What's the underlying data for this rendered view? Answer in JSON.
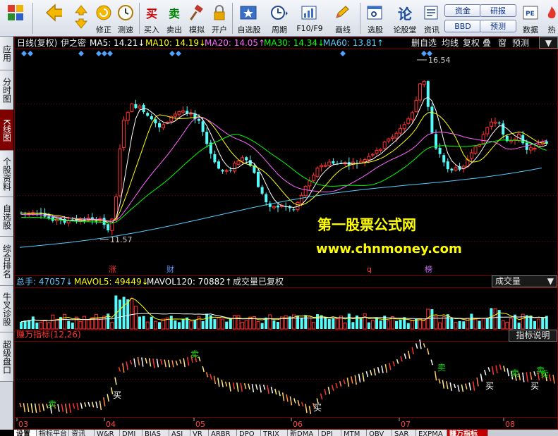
{
  "toolbar": {
    "buttons": [
      {
        "name": "fupan-button",
        "label": "",
        "icon": "grid-logo-icon"
      },
      {
        "name": "back-button",
        "label": "",
        "icon": "back-arrow-icon"
      },
      {
        "name": "up-button",
        "label": "",
        "icon": "up-arrow-icon"
      },
      {
        "name": "down-button",
        "label": "",
        "icon": "down-arrow-icon"
      },
      {
        "name": "xiuzheng-button",
        "label": "修正",
        "icon": "refresh-circle-icon"
      },
      {
        "name": "cesu-button",
        "label": "测速",
        "icon": "clock-icon"
      },
      {
        "name": "buy-button",
        "label": "买入",
        "icon": "buy-char-icon"
      },
      {
        "name": "sell-button",
        "label": "卖出",
        "icon": "sell-char-icon"
      },
      {
        "name": "simulate-button",
        "label": "模拟",
        "icon": "hammer-icon"
      },
      {
        "name": "open-account-button",
        "label": "开户",
        "icon": "lock-icon"
      },
      {
        "name": "watchlist-button",
        "label": "自选股",
        "icon": "star-window-icon"
      },
      {
        "name": "period-button",
        "label": "周期",
        "icon": "period-icon"
      },
      {
        "name": "f10-button",
        "label": "F10/F9",
        "icon": "f10-icon"
      },
      {
        "name": "drawline-button",
        "label": "画线",
        "icon": "pencil-icon"
      },
      {
        "name": "select-stock-button",
        "label": "选股",
        "icon": "select-window-icon"
      },
      {
        "name": "forum-button",
        "label": "论股堂",
        "icon": "forum-char-icon"
      },
      {
        "name": "info-button",
        "label": "资讯",
        "icon": "info-icon"
      },
      {
        "name": "data-button",
        "label": "数据",
        "icon": "pe-icon"
      },
      {
        "name": "hot-button",
        "label": "热",
        "icon": "fire-icon"
      }
    ],
    "pills": [
      "资金",
      "研报",
      "BBD",
      "预测"
    ]
  },
  "left_tabs": [
    {
      "label": "应用",
      "active": false
    },
    {
      "label": "分时图",
      "active": false
    },
    {
      "label": "K线图",
      "active": true
    },
    {
      "label": "个股资料",
      "active": false
    },
    {
      "label": "自选股",
      "active": false
    },
    {
      "label": "综合排名",
      "active": false
    },
    {
      "label": "牛叉诊股",
      "active": false
    },
    {
      "label": "超级盘口",
      "active": false
    }
  ],
  "main_header": {
    "period": "日线(复权)",
    "stock": "伊之密",
    "ma": [
      {
        "label": "MA5:",
        "value": "14.21",
        "arrow": "↓",
        "color": "#ffffff"
      },
      {
        "label": "MA10:",
        "value": "14.19",
        "arrow": "↓",
        "color": "#ffff00"
      },
      {
        "label": "MA20:",
        "value": "14.05",
        "arrow": "↑",
        "color": "#ff66ff"
      },
      {
        "label": "MA30:",
        "value": "14.34",
        "arrow": "↓",
        "color": "#00ff00"
      },
      {
        "label": "MA60:",
        "value": "13.81",
        "arrow": "↑",
        "color": "#55ccff"
      }
    ],
    "right_tools": [
      "删自选",
      "均线",
      "复权",
      "叠",
      "窗",
      "预测"
    ]
  },
  "price_labels": {
    "high": "16.54",
    "low": "11.57"
  },
  "event_markers": [
    {
      "label": "涨",
      "color": "#ff3333"
    },
    {
      "label": "财",
      "color": "#5599ff"
    },
    {
      "label": "q",
      "color": "#ff3333"
    },
    {
      "label": "榜",
      "color": "#cc66ff"
    }
  ],
  "watermark": {
    "line1": "第一股票公式网",
    "line2": "www.chnmoney.com"
  },
  "volume_header": {
    "items": [
      {
        "label": "总手:",
        "value": "47057",
        "arrow": "↓",
        "color": "#55ccff"
      },
      {
        "label": "MAVOL5:",
        "value": "49449",
        "arrow": "↓",
        "color": "#ffff00"
      },
      {
        "label": "MAVOL120:",
        "value": "70882",
        "arrow": "↑",
        "color": "#ffffff"
      }
    ],
    "note": "成交量已复权",
    "dropdown": "成交量"
  },
  "indicator_header": {
    "title": "赚万指标(12,26)",
    "explain": "指标说明"
  },
  "signals": [
    {
      "label": "卖",
      "color": "#00dd00"
    },
    {
      "label": "买",
      "color": "#ffffff"
    },
    {
      "label": "卖",
      "color": "#00dd00"
    },
    {
      "label": "买",
      "color": "#ffffff"
    },
    {
      "label": "卖",
      "color": "#00dd00"
    },
    {
      "label": "买",
      "color": "#ffffff"
    },
    {
      "label": "卖",
      "color": "#00dd00"
    },
    {
      "label": "卖",
      "color": "#00dd00"
    },
    {
      "label": "买",
      "color": "#ffffff"
    },
    {
      "label": "卖",
      "color": "#00dd00"
    }
  ],
  "x_axis": [
    "03",
    "04",
    "05",
    "06",
    "07",
    "08"
  ],
  "bottom_tabs": [
    {
      "label": "设置",
      "style": "active"
    },
    {
      "label": "指标平台",
      "style": ""
    },
    {
      "label": "资讯",
      "style": ""
    },
    {
      "label": "W&R",
      "style": ""
    },
    {
      "label": "DMI",
      "style": ""
    },
    {
      "label": "BIAS",
      "style": ""
    },
    {
      "label": "ASI",
      "style": ""
    },
    {
      "label": "VR",
      "style": ""
    },
    {
      "label": "ARBR",
      "style": ""
    },
    {
      "label": "DPO",
      "style": ""
    },
    {
      "label": "TRIX",
      "style": ""
    },
    {
      "label": "新DMA",
      "style": ""
    },
    {
      "label": "DPI",
      "style": ""
    },
    {
      "label": "MTM",
      "style": ""
    },
    {
      "label": "OBV",
      "style": ""
    },
    {
      "label": "SAR",
      "style": ""
    },
    {
      "label": "EXPMA",
      "style": ""
    },
    {
      "label": "赚万指标",
      "style": "red"
    }
  ],
  "colors": {
    "up": "#ff3333",
    "down": "#54fcfc",
    "bg": "#000000",
    "grid": "#7a0000"
  }
}
